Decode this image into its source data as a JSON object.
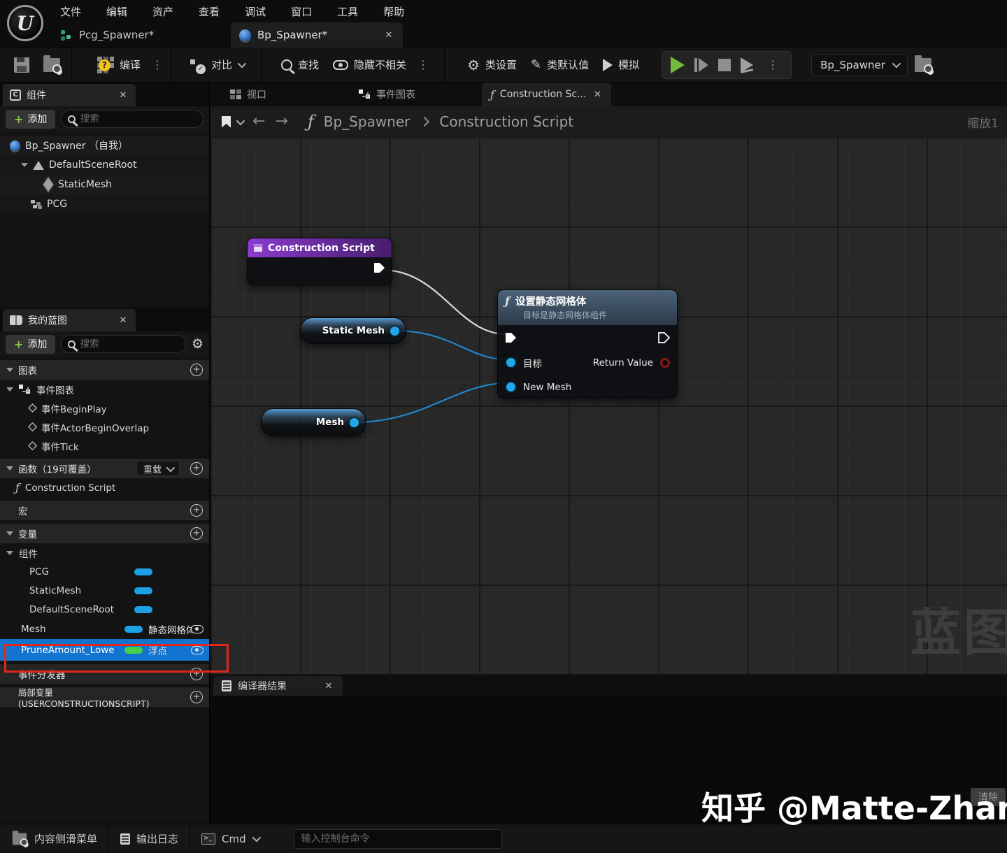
{
  "window": {
    "menu": [
      "文件",
      "编辑",
      "资产",
      "查看",
      "调试",
      "窗口",
      "工具",
      "帮助"
    ],
    "tabs": {
      "pcg": "Pcg_Spawner*",
      "bp": "Bp_Spawner*"
    }
  },
  "toolbar": {
    "compile": "编译",
    "diff": "对比",
    "find": "查找",
    "hide_unrelated": "隐藏不相关",
    "class_settings": "类设置",
    "class_defaults": "类默认值",
    "simulate": "模拟",
    "debug_target": "Bp_Spawner"
  },
  "components": {
    "title": "组件",
    "add": "添加",
    "search": "搜索",
    "root": "Bp_Spawner （自我）",
    "scene_root": "DefaultSceneRoot",
    "static_mesh": "StaticMesh",
    "pcg": "PCG"
  },
  "mbp": {
    "title": "我的蓝图",
    "add": "添加",
    "search": "搜索",
    "graphs_header": "图表",
    "event_graph": "事件图表",
    "events": [
      "事件BeginPlay",
      "事件ActorBeginOverlap",
      "事件Tick"
    ],
    "functions_header": "函数（19可覆盖）",
    "overload": "重载",
    "construction_script": "Construction Script",
    "macros_header": "宏",
    "variables_header": "变量",
    "components_header": "组件",
    "component_vars": [
      "PCG",
      "StaticMesh",
      "DefaultSceneRoot"
    ],
    "mesh_var": {
      "name": "Mesh",
      "type": "静态网格体"
    },
    "selected_var": {
      "name": "PruneAmount_Lowe",
      "type": "浮点"
    },
    "dispatchers_header": "事件分发器",
    "locals_header": "局部变量 (USERCONSTRUCTIONSCRIPT)"
  },
  "graph": {
    "tabs": {
      "viewport": "视口",
      "event_graph": "事件图表",
      "construction": "Construction Sc..."
    },
    "breadcrumb": {
      "root": "Bp_Spawner",
      "current": "Construction Script"
    },
    "zoom_label": "缩放1",
    "watermark": "蓝图",
    "nodes": {
      "cs_title": "Construction Script",
      "static_pill": "Static Mesh",
      "mesh_pill": "Mesh",
      "set": {
        "title": "设置静态网格体",
        "subtitle": "目标是静态网格体组件",
        "target": "目标",
        "return_value": "Return Value",
        "new_mesh": "New Mesh"
      }
    }
  },
  "compiler": {
    "tab": "编译器结果",
    "clear": "清除"
  },
  "statusbar": {
    "content_drawer": "内容侧滑菜单",
    "output_log": "输出日志",
    "cmd": "Cmd",
    "console_placeholder": "输入控制台命令"
  },
  "overlay": {
    "credit": "知乎 @Matte-Zhang"
  },
  "colors": {
    "selection_blue": "#1374d0",
    "annotation_red": "#e3261d",
    "play_green": "#71bc3d",
    "data_pin_blue": "#1fa7e8",
    "float_pill_green": "#43d14c",
    "object_pill_blue": "#1ba2e6",
    "node_header_purple": "#8a3bd0",
    "node_header_steel": "#4c6278",
    "compile_badge_yellow": "#f5c518"
  }
}
